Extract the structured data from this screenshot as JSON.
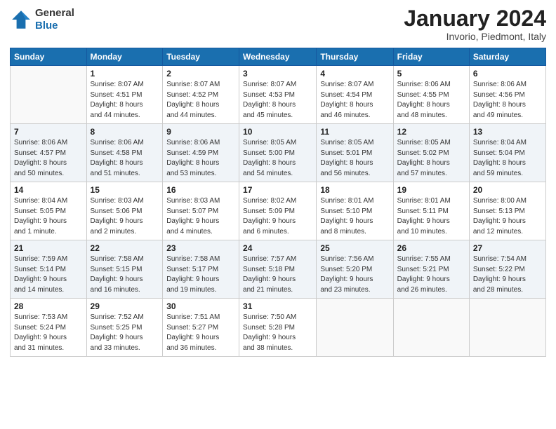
{
  "header": {
    "logo_line1": "General",
    "logo_line2": "Blue",
    "month": "January 2024",
    "location": "Invorio, Piedmont, Italy"
  },
  "weekdays": [
    "Sunday",
    "Monday",
    "Tuesday",
    "Wednesday",
    "Thursday",
    "Friday",
    "Saturday"
  ],
  "weeks": [
    {
      "alt": false,
      "days": [
        {
          "num": "",
          "info": ""
        },
        {
          "num": "1",
          "info": "Sunrise: 8:07 AM\nSunset: 4:51 PM\nDaylight: 8 hours\nand 44 minutes."
        },
        {
          "num": "2",
          "info": "Sunrise: 8:07 AM\nSunset: 4:52 PM\nDaylight: 8 hours\nand 44 minutes."
        },
        {
          "num": "3",
          "info": "Sunrise: 8:07 AM\nSunset: 4:53 PM\nDaylight: 8 hours\nand 45 minutes."
        },
        {
          "num": "4",
          "info": "Sunrise: 8:07 AM\nSunset: 4:54 PM\nDaylight: 8 hours\nand 46 minutes."
        },
        {
          "num": "5",
          "info": "Sunrise: 8:06 AM\nSunset: 4:55 PM\nDaylight: 8 hours\nand 48 minutes."
        },
        {
          "num": "6",
          "info": "Sunrise: 8:06 AM\nSunset: 4:56 PM\nDaylight: 8 hours\nand 49 minutes."
        }
      ]
    },
    {
      "alt": true,
      "days": [
        {
          "num": "7",
          "info": "Sunrise: 8:06 AM\nSunset: 4:57 PM\nDaylight: 8 hours\nand 50 minutes."
        },
        {
          "num": "8",
          "info": "Sunrise: 8:06 AM\nSunset: 4:58 PM\nDaylight: 8 hours\nand 51 minutes."
        },
        {
          "num": "9",
          "info": "Sunrise: 8:06 AM\nSunset: 4:59 PM\nDaylight: 8 hours\nand 53 minutes."
        },
        {
          "num": "10",
          "info": "Sunrise: 8:05 AM\nSunset: 5:00 PM\nDaylight: 8 hours\nand 54 minutes."
        },
        {
          "num": "11",
          "info": "Sunrise: 8:05 AM\nSunset: 5:01 PM\nDaylight: 8 hours\nand 56 minutes."
        },
        {
          "num": "12",
          "info": "Sunrise: 8:05 AM\nSunset: 5:02 PM\nDaylight: 8 hours\nand 57 minutes."
        },
        {
          "num": "13",
          "info": "Sunrise: 8:04 AM\nSunset: 5:04 PM\nDaylight: 8 hours\nand 59 minutes."
        }
      ]
    },
    {
      "alt": false,
      "days": [
        {
          "num": "14",
          "info": "Sunrise: 8:04 AM\nSunset: 5:05 PM\nDaylight: 9 hours\nand 1 minute."
        },
        {
          "num": "15",
          "info": "Sunrise: 8:03 AM\nSunset: 5:06 PM\nDaylight: 9 hours\nand 2 minutes."
        },
        {
          "num": "16",
          "info": "Sunrise: 8:03 AM\nSunset: 5:07 PM\nDaylight: 9 hours\nand 4 minutes."
        },
        {
          "num": "17",
          "info": "Sunrise: 8:02 AM\nSunset: 5:09 PM\nDaylight: 9 hours\nand 6 minutes."
        },
        {
          "num": "18",
          "info": "Sunrise: 8:01 AM\nSunset: 5:10 PM\nDaylight: 9 hours\nand 8 minutes."
        },
        {
          "num": "19",
          "info": "Sunrise: 8:01 AM\nSunset: 5:11 PM\nDaylight: 9 hours\nand 10 minutes."
        },
        {
          "num": "20",
          "info": "Sunrise: 8:00 AM\nSunset: 5:13 PM\nDaylight: 9 hours\nand 12 minutes."
        }
      ]
    },
    {
      "alt": true,
      "days": [
        {
          "num": "21",
          "info": "Sunrise: 7:59 AM\nSunset: 5:14 PM\nDaylight: 9 hours\nand 14 minutes."
        },
        {
          "num": "22",
          "info": "Sunrise: 7:58 AM\nSunset: 5:15 PM\nDaylight: 9 hours\nand 16 minutes."
        },
        {
          "num": "23",
          "info": "Sunrise: 7:58 AM\nSunset: 5:17 PM\nDaylight: 9 hours\nand 19 minutes."
        },
        {
          "num": "24",
          "info": "Sunrise: 7:57 AM\nSunset: 5:18 PM\nDaylight: 9 hours\nand 21 minutes."
        },
        {
          "num": "25",
          "info": "Sunrise: 7:56 AM\nSunset: 5:20 PM\nDaylight: 9 hours\nand 23 minutes."
        },
        {
          "num": "26",
          "info": "Sunrise: 7:55 AM\nSunset: 5:21 PM\nDaylight: 9 hours\nand 26 minutes."
        },
        {
          "num": "27",
          "info": "Sunrise: 7:54 AM\nSunset: 5:22 PM\nDaylight: 9 hours\nand 28 minutes."
        }
      ]
    },
    {
      "alt": false,
      "days": [
        {
          "num": "28",
          "info": "Sunrise: 7:53 AM\nSunset: 5:24 PM\nDaylight: 9 hours\nand 31 minutes."
        },
        {
          "num": "29",
          "info": "Sunrise: 7:52 AM\nSunset: 5:25 PM\nDaylight: 9 hours\nand 33 minutes."
        },
        {
          "num": "30",
          "info": "Sunrise: 7:51 AM\nSunset: 5:27 PM\nDaylight: 9 hours\nand 36 minutes."
        },
        {
          "num": "31",
          "info": "Sunrise: 7:50 AM\nSunset: 5:28 PM\nDaylight: 9 hours\nand 38 minutes."
        },
        {
          "num": "",
          "info": ""
        },
        {
          "num": "",
          "info": ""
        },
        {
          "num": "",
          "info": ""
        }
      ]
    }
  ]
}
